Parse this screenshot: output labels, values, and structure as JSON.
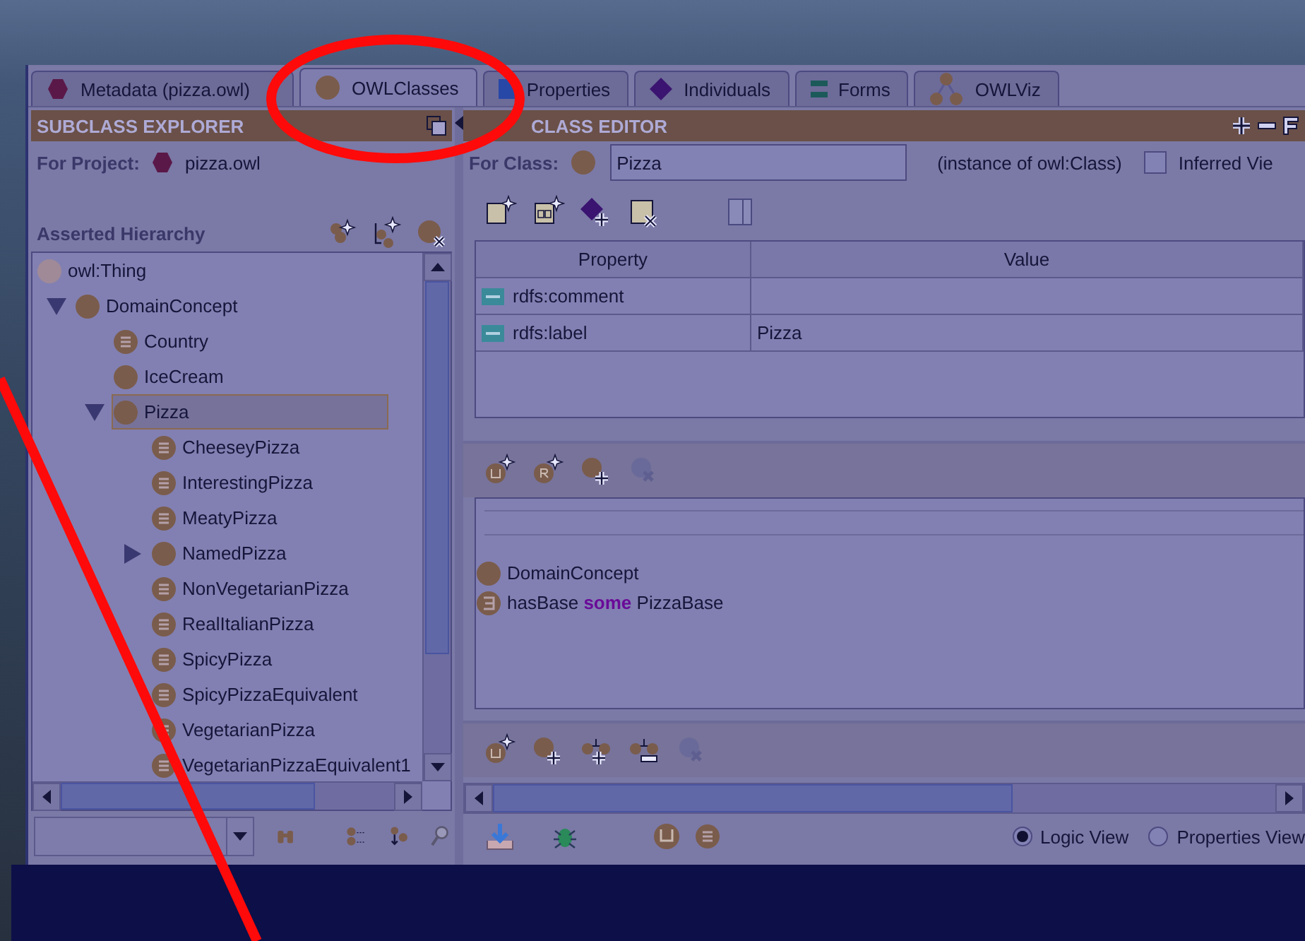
{
  "tabs": [
    {
      "label": "Metadata (pizza.owl)",
      "kind": "hexagon",
      "selected": false
    },
    {
      "label": "OWLClasses",
      "kind": "circle",
      "selected": true
    },
    {
      "label": "Properties",
      "kind": "square",
      "selected": false
    },
    {
      "label": "Individuals",
      "kind": "diamond",
      "selected": false
    },
    {
      "label": "Forms",
      "kind": "bars",
      "selected": false
    },
    {
      "label": "OWLViz",
      "kind": "tree",
      "selected": false
    }
  ],
  "subclass_explorer": {
    "title": "SUBCLASS EXPLORER",
    "project_label": "For Project:",
    "project": "pizza.owl",
    "hierarchy_title": "Asserted Hierarchy",
    "tree": [
      {
        "label": "owl:Thing",
        "kind": "thing",
        "selected": false,
        "children": [
          {
            "label": "DomainConcept",
            "kind": "primitive",
            "expanded": true,
            "selected": false,
            "children": [
              {
                "label": "Country",
                "kind": "defined",
                "selected": false
              },
              {
                "label": "IceCream",
                "kind": "primitive",
                "selected": false
              },
              {
                "label": "Pizza",
                "kind": "primitive",
                "expanded": true,
                "selected": true,
                "children": [
                  {
                    "label": "CheeseyPizza",
                    "kind": "defined",
                    "selected": false
                  },
                  {
                    "label": "InterestingPizza",
                    "kind": "defined",
                    "selected": false
                  },
                  {
                    "label": "MeatyPizza",
                    "kind": "defined",
                    "selected": false
                  },
                  {
                    "label": "NamedPizza",
                    "kind": "primitive",
                    "expanded": false,
                    "selected": false
                  },
                  {
                    "label": "NonVegetarianPizza",
                    "kind": "defined",
                    "selected": false
                  },
                  {
                    "label": "RealItalianPizza",
                    "kind": "defined",
                    "selected": false
                  },
                  {
                    "label": "SpicyPizza",
                    "kind": "defined",
                    "selected": false
                  },
                  {
                    "label": "SpicyPizzaEquivalent",
                    "kind": "defined",
                    "selected": false
                  },
                  {
                    "label": "VegetarianPizza",
                    "kind": "defined",
                    "selected": false
                  },
                  {
                    "label": "VegetarianPizzaEquivalent1",
                    "kind": "defined",
                    "selected": false
                  }
                ]
              }
            ]
          }
        ]
      }
    ]
  },
  "class_editor": {
    "title": "CLASS EDITOR",
    "class_label": "For Class:",
    "class_name": "Pizza",
    "instance_of": "(instance of owl:Class)",
    "inferred_view": {
      "label": "Inferred Vie",
      "checked": false
    },
    "table": {
      "columns": [
        "Property",
        "Value"
      ],
      "rows": [
        {
          "property": "rdfs:comment"
        },
        {
          "property": "rdfs:label",
          "value": "Pizza"
        }
      ]
    },
    "conditions": [
      {
        "kind": "primitive",
        "text": "DomainConcept"
      },
      {
        "kind": "existential",
        "text": "hasBase **some** PizzaBase"
      }
    ],
    "view_options": [
      {
        "label": "Logic View",
        "selected": true
      },
      {
        "label": "Properties View",
        "selected": false
      }
    ]
  }
}
